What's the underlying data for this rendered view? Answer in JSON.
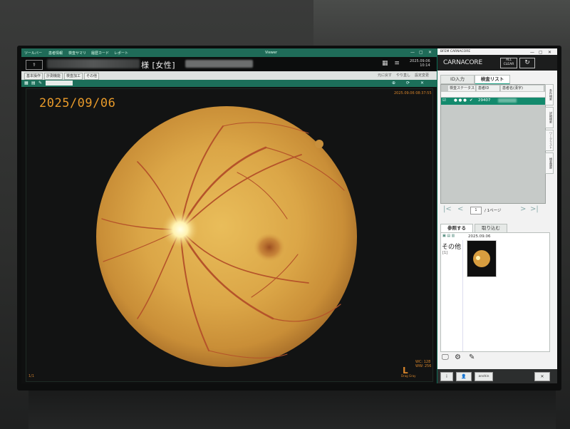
{
  "viewer": {
    "title": "Viewer",
    "menu_items": [
      "ツールバー",
      "患者情報",
      "検査サマリ",
      "履歴カード",
      "レポート"
    ],
    "patient_info": "様 [女性]",
    "datetime_line1": "2025.09.06",
    "datetime_line2": "10:14",
    "toolbar": [
      "基本操作",
      "計測機能",
      "検査加工",
      "その他"
    ],
    "toolbar_right": [
      "元に戻す",
      "やり直し",
      "設定変更"
    ],
    "image_date": "2025/09/06",
    "image_meta": "2025.09.06 08:37:55",
    "wc": "WC: 128",
    "ww": "WW: 256",
    "drag_text": "Drag  Gray",
    "corner_letter": "L",
    "bottom_left": "1/1"
  },
  "app": {
    "title": "BFEM CARNACORE",
    "brand": "CARNACORE",
    "all_clear": "ALL CLEAR",
    "refresh_icon": "↻",
    "tabs": [
      "ID入力",
      "検査リスト"
    ],
    "table_headers": [
      "検査ステータス",
      "患者ID",
      "患者名(漢字)"
    ],
    "row_id": "29407",
    "side_tabs": [
      "条件検索",
      "詳細検索",
      "ワークリスト",
      "検査履歴"
    ],
    "pager_page": "1",
    "pager_total": "/ 1ページ",
    "ref_tabs": [
      "参照する",
      "取り込む"
    ],
    "ref_date": "2025.09.06",
    "ref_category": "その他",
    "ref_count": "[1]",
    "footer_buttons": [
      "i",
      "👤",
      "anshin",
      "✕"
    ],
    "colors": {
      "accent": "#138a6d",
      "header": "#1c1d1d"
    }
  }
}
